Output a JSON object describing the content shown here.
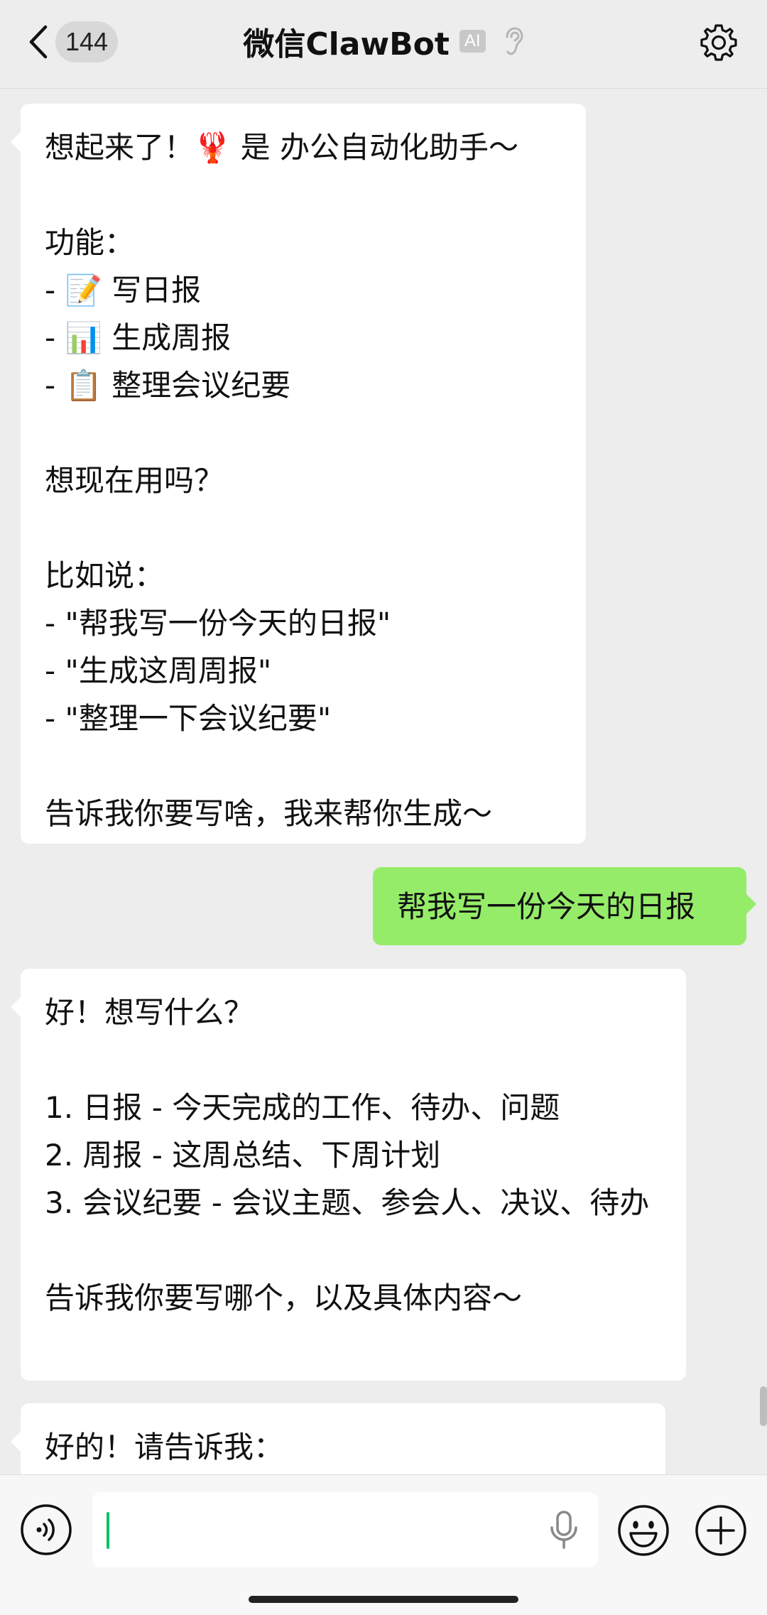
{
  "header": {
    "back_label": "<",
    "unread_count": "144",
    "title": "微信ClawBot",
    "ai_badge": "AI",
    "icons": {
      "back": "chevron-left-icon",
      "ear": "ear-icon",
      "settings": "gear-icon"
    }
  },
  "messages": [
    {
      "sender": "bot",
      "text": "想起来了！🦞 是 办公自动化助手～\n\n功能：\n- 📝 写日报\n- 📊 生成周报\n- 📋 整理会议纪要\n\n想现在用吗？\n\n比如说：\n- \"帮我写一份今天的日报\"\n- \"生成这周周报\"\n- \"整理一下会议纪要\"\n\n告诉我你要写啥，我来帮你生成～"
    },
    {
      "sender": "user",
      "text": "帮我写一份今天的日报"
    },
    {
      "sender": "bot",
      "text": "好！想写什么？\n\n1. 日报 - 今天完成的工作、待办、问题\n2. 周报 - 这周总结、下周计划\n3. 会议纪要 - 会议主题、参会人、决议、待办\n\n告诉我你要写哪个，以及具体内容～"
    },
    {
      "sender": "bot",
      "text": "好的！请告诉我："
    }
  ],
  "input": {
    "value": "",
    "placeholder": "",
    "icons": {
      "voice": "voice-mode-icon",
      "mic": "microphone-icon",
      "emoji": "emoji-icon",
      "plus": "plus-icon"
    }
  },
  "colors": {
    "background": "#ededed",
    "bot_bubble": "#ffffff",
    "user_bubble": "#95ec69",
    "caret": "#07c160"
  }
}
